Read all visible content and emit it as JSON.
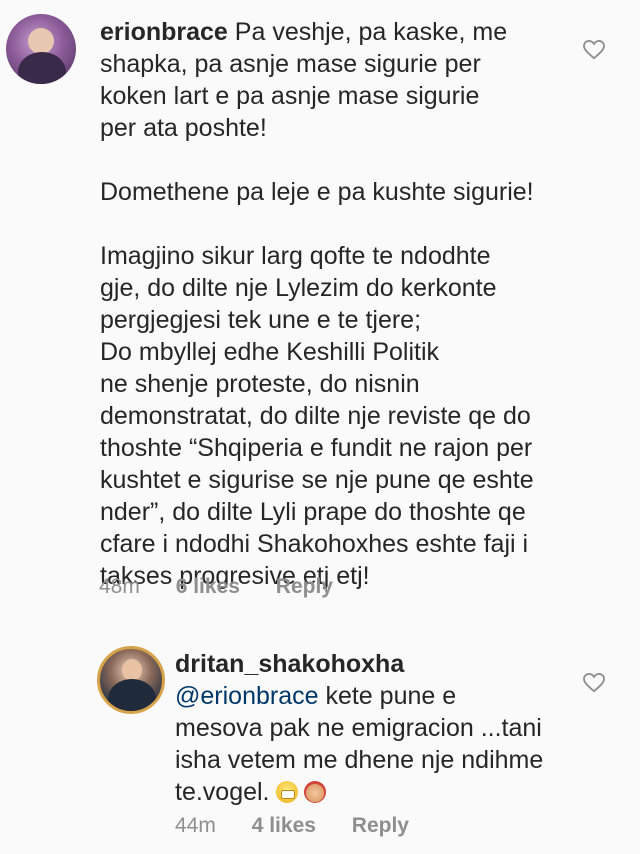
{
  "comments": [
    {
      "username": "erionbrace",
      "text": "Pa veshje, pa kaske, me\nshapka, pa asnje mase sigurie per\nkoken lart e pa asnje mase sigurie\nper ata poshte!\n\nDomethene pa leje e pa kushte sigurie!\n\nImagjino sikur larg qofte te ndodhte\ngje, do dilte nje Lylezim do kerkonte\npergjegjesi tek une e te tjere;\nDo mbyllej edhe Keshilli Politik\nne shenje proteste, do nisnin\ndemonstratat, do dilte nje reviste qe do\nthoshte “Shqiperia e fundit ne rajon per\nkushtet e sigurise se nje pune qe eshte\nnder”, do dilte Lyli prape do thoshte qe\ncfare i ndodhi Shakohoxhes eshte faji i\ntakses progresive etj etj!",
      "time": "48m",
      "likes": "6 likes",
      "reply": "Reply"
    },
    {
      "username": "dritan_shakohoxha",
      "mention": "@erionbrace",
      "text": " kete pune e\nmesova pak ne emigracion ...tani\nisha vetem me dhene nje ndihme\nte.vogel.",
      "time": "44m",
      "likes": "4 likes",
      "reply": "Reply"
    }
  ],
  "icons": {
    "like": "heart-outline-icon",
    "emoji1": "grimacing-face-emoji",
    "emoji2": "firefighter-emoji"
  },
  "colors": {
    "text": "#262626",
    "muted": "#8e8e8e",
    "mention": "#00376b",
    "background": "#fafafa"
  }
}
